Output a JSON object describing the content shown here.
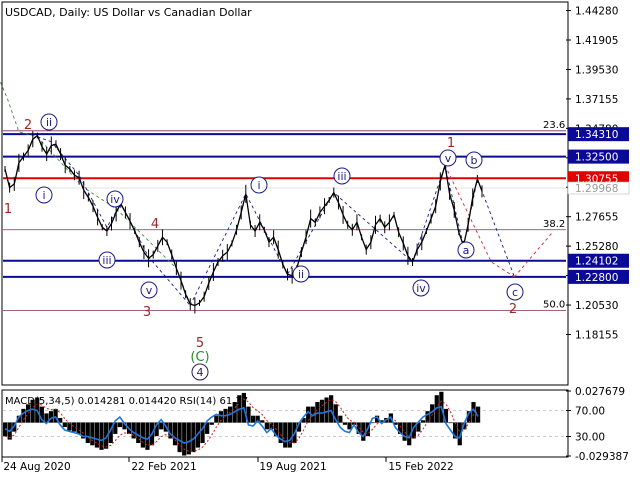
{
  "header": {
    "symbol_line": "USDCAD, Daily:  US Dollar vs Canadian Dollar"
  },
  "chart_data": {
    "type": "line",
    "title": "USDCAD, Daily:  US Dollar vs Canadian Dollar",
    "price_axis": {
      "ylim": [
        1.1416,
        1.4489
      ],
      "ticks": [
        "1.44280",
        "1.41905",
        "1.39530",
        "1.37155",
        "1.34780",
        "1.32405",
        "1.30030",
        "1.27655",
        "1.25280",
        "1.22905",
        "1.20530",
        "1.18155"
      ]
    },
    "time_axis": {
      "ticks": [
        "24 Aug 2020",
        "22 Feb 2021",
        "19 Aug 2021",
        "15 Feb 2022"
      ]
    },
    "series": [
      {
        "values": [
          1.315,
          1.3,
          1.303,
          1.32,
          1.325,
          1.33,
          1.339,
          1.342,
          1.333,
          1.327,
          1.334,
          1.335,
          1.327,
          1.318,
          1.315,
          1.31,
          1.308,
          1.298,
          1.292,
          1.285,
          1.276,
          1.268,
          1.265,
          1.271,
          1.28,
          1.287,
          1.28,
          1.273,
          1.265,
          1.256,
          1.248,
          1.243,
          1.246,
          1.253,
          1.26,
          1.256,
          1.246,
          1.235,
          1.225,
          1.214,
          1.206,
          1.205,
          1.207,
          1.212,
          1.223,
          1.232,
          1.24,
          1.245,
          1.248,
          1.255,
          1.266,
          1.28,
          1.295,
          1.27,
          1.265,
          1.272,
          1.266,
          1.256,
          1.26,
          1.25,
          1.238,
          1.23,
          1.229,
          1.235,
          1.248,
          1.26,
          1.275,
          1.272,
          1.28,
          1.285,
          1.29,
          1.296,
          1.288,
          1.278,
          1.27,
          1.266,
          1.272,
          1.26,
          1.25,
          1.256,
          1.27,
          1.275,
          1.268,
          1.272,
          1.278,
          1.264,
          1.255,
          1.245,
          1.24,
          1.25,
          1.256,
          1.265,
          1.275,
          1.285,
          1.305,
          1.318,
          1.295,
          1.282,
          1.264,
          1.253,
          1.27,
          1.292,
          1.307,
          1.297
        ],
        "color": "#000000"
      }
    ],
    "horizontal_levels": [
      {
        "label": "1.34310",
        "value": 1.3431,
        "color": "#0a0a96"
      },
      {
        "label": "1.32500",
        "value": 1.325,
        "color": "#0a0a96"
      },
      {
        "label": "1.30755",
        "value": 1.30755,
        "color": "#e00000"
      },
      {
        "label": "1.24102",
        "value": 1.24102,
        "color": "#0a0a96"
      },
      {
        "label": "1.22800",
        "value": 1.228,
        "color": "#0a0a96"
      }
    ],
    "current_price": {
      "label": "1.29968",
      "value": 1.29968
    },
    "fibonacci": [
      {
        "label": "23.6",
        "value": 1.3458
      },
      {
        "label": "38.2",
        "value": 1.266
      },
      {
        "label": "50.0",
        "value": 1.201
      }
    ],
    "wave_labels": [
      {
        "text": "2",
        "style": "plain-red"
      },
      {
        "text": "ii",
        "style": "circled"
      },
      {
        "text": "i",
        "style": "circled"
      },
      {
        "text": "1",
        "style": "plain-red"
      },
      {
        "text": "iv",
        "style": "circled"
      },
      {
        "text": "iii",
        "style": "circled"
      },
      {
        "text": "4",
        "style": "plain-red"
      },
      {
        "text": "v",
        "style": "circled"
      },
      {
        "text": "3",
        "style": "plain-red"
      },
      {
        "text": "5",
        "style": "plain-red"
      },
      {
        "text": "C",
        "style": "paren-green"
      },
      {
        "text": "4",
        "style": "circled-dark"
      },
      {
        "text": "i",
        "style": "circled"
      },
      {
        "text": "ii",
        "style": "circled"
      },
      {
        "text": "iii",
        "style": "circled"
      },
      {
        "text": "iv",
        "style": "circled"
      },
      {
        "text": "1",
        "style": "plain-red"
      },
      {
        "text": "v",
        "style": "circled"
      },
      {
        "text": "b",
        "style": "circled"
      },
      {
        "text": "a",
        "style": "circled"
      },
      {
        "text": "c",
        "style": "circled"
      },
      {
        "text": "2",
        "style": "plain-red"
      }
    ]
  },
  "indicator": {
    "label": "MACD(5,34,5) 0.014281 0.014420 RSI(14) 61.37",
    "right_axis_ticks": [
      "0.027679",
      "70.00",
      "30.00",
      "-0.029387"
    ],
    "macd_hist": [
      -0.012,
      -0.015,
      -0.008,
      0.006,
      0.012,
      0.016,
      0.02,
      0.022,
      0.014,
      0.008,
      0.01,
      0.012,
      0.004,
      -0.004,
      -0.007,
      -0.008,
      -0.01,
      -0.014,
      -0.018,
      -0.02,
      -0.022,
      -0.024,
      -0.023,
      -0.018,
      -0.01,
      -0.004,
      -0.006,
      -0.01,
      -0.014,
      -0.018,
      -0.022,
      -0.024,
      -0.02,
      -0.012,
      -0.006,
      -0.008,
      -0.014,
      -0.02,
      -0.026,
      -0.029,
      -0.028,
      -0.026,
      -0.022,
      -0.018,
      -0.01,
      -0.002,
      0.006,
      0.01,
      0.012,
      0.014,
      0.018,
      0.024,
      0.026,
      0.014,
      0.006,
      0.006,
      0.002,
      -0.006,
      -0.006,
      -0.012,
      -0.018,
      -0.022,
      -0.022,
      -0.018,
      -0.008,
      0.004,
      0.014,
      0.014,
      0.018,
      0.02,
      0.022,
      0.024,
      0.016,
      0.006,
      -0.002,
      -0.006,
      -0.002,
      -0.01,
      -0.016,
      -0.012,
      0.0,
      0.006,
      0.002,
      0.004,
      0.008,
      -0.002,
      -0.01,
      -0.016,
      -0.02,
      -0.014,
      -0.008,
      0.002,
      0.01,
      0.016,
      0.024,
      0.027,
      0.012,
      0.0,
      -0.014,
      -0.02,
      -0.006,
      0.01,
      0.018,
      0.014
    ],
    "rsi": [
      42,
      38,
      46,
      60,
      66,
      70,
      72,
      70,
      56,
      50,
      58,
      60,
      48,
      40,
      38,
      36,
      34,
      30,
      30,
      28,
      26,
      24,
      28,
      40,
      54,
      60,
      50,
      42,
      36,
      32,
      28,
      26,
      34,
      48,
      56,
      46,
      34,
      28,
      24,
      20,
      22,
      26,
      34,
      42,
      54,
      60,
      64,
      62,
      62,
      64,
      68,
      72,
      74,
      48,
      46,
      54,
      46,
      36,
      42,
      32,
      26,
      22,
      24,
      34,
      50,
      60,
      68,
      62,
      66,
      66,
      68,
      70,
      56,
      44,
      38,
      36,
      48,
      36,
      30,
      42,
      58,
      60,
      50,
      56,
      60,
      44,
      36,
      30,
      28,
      44,
      52,
      60,
      64,
      68,
      74,
      76,
      50,
      40,
      30,
      28,
      50,
      66,
      72,
      61
    ]
  }
}
